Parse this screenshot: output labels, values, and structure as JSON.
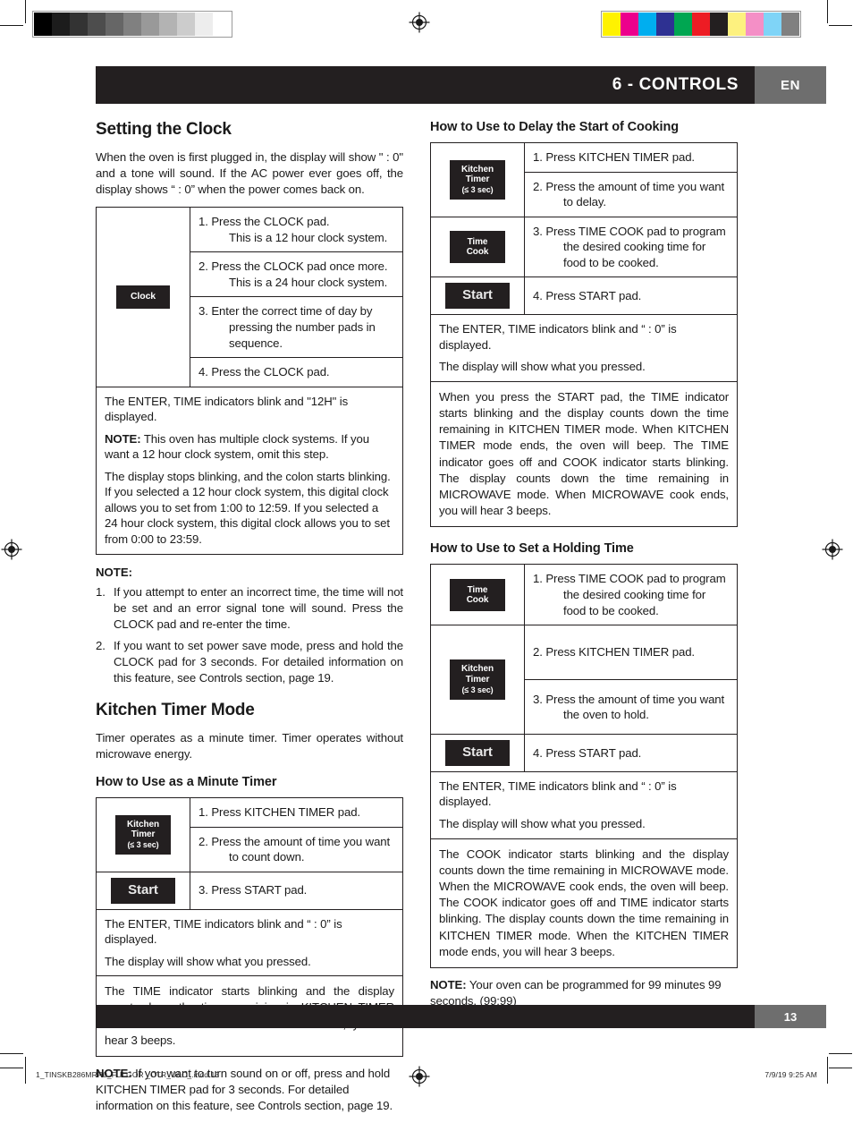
{
  "header": {
    "title": "6 - CONTROLS",
    "language": "EN"
  },
  "footer": {
    "page_number": "13"
  },
  "print_slug": {
    "filename": "1_TINSKB286MRR0_FULGOR _OTR_U&C_.indd   13",
    "timestamp": "7/9/19   9:25 AM"
  },
  "calibration": {
    "gray_wedge": [
      "#000000",
      "#1c1c1c",
      "#333333",
      "#4d4d4d",
      "#666666",
      "#808080",
      "#999999",
      "#b3b3b3",
      "#cccccc",
      "#ededed",
      "#ffffff"
    ],
    "color_bars": [
      "#fff200",
      "#ec008c",
      "#00aeef",
      "#2e3192",
      "#00a651",
      "#ed1c24",
      "#231f20",
      "#fdf17f",
      "#f48fc6",
      "#7fd4f7",
      "#808080"
    ],
    "registration_mark": "registration-target"
  },
  "pads": {
    "clock": {
      "line1": "Clock"
    },
    "kitchen_timer": {
      "line1": "Kitchen",
      "line2": "Timer",
      "line3": "(≤ 3 sec)"
    },
    "time_cook": {
      "line1": "Time",
      "line2": "Cook"
    },
    "start": {
      "line1": "Start"
    }
  },
  "left_column": {
    "setting_clock": {
      "heading": "Setting the Clock",
      "intro": "When the oven is first plugged in, the display will show \" : 0\" and a tone will sound. If the AC power ever goes off, the display shows “ : 0” when the power comes back on.",
      "table": {
        "pad": "clock",
        "steps": [
          {
            "main": "1. Press the CLOCK pad.",
            "cont": "This is a 12 hour clock system."
          },
          {
            "main": "2. Press the CLOCK pad once more.",
            "cont": "This is a 24 hour clock system."
          },
          {
            "main": "3. Enter the correct time of day by",
            "cont": "pressing the number pads in sequence."
          },
          {
            "main": "4. Press the CLOCK pad.",
            "cont": ""
          }
        ],
        "result_rows": [
          {
            "lines": [
              "The ENTER, TIME indicators blink and \"12H\" is displayed.",
              "NOTE: This oven has multiple clock systems. If you want a 12 hour clock system, omit this step.",
              "The display stops blinking, and the colon starts blinking. If you selected a 12 hour clock system, this digital clock allows you to set from 1:00 to 12:59. If you selected a 24 hour clock system, this digital clock allows you to set from 0:00 to 23:59."
            ]
          }
        ]
      },
      "note_heading": "NOTE:",
      "notes": [
        {
          "num": "1.",
          "text": "If you attempt to enter an incorrect time, the time will not be set and an error signal tone will sound. Press the CLOCK pad and re-enter the time."
        },
        {
          "num": "2.",
          "text": "If you want to set power save mode, press and hold the CLOCK pad for 3 seconds. For detailed information on this feature, see Controls section, page 19."
        }
      ]
    },
    "kitchen_timer_mode": {
      "heading": "Kitchen Timer Mode",
      "intro": "Timer operates as a minute timer. Timer operates without microwave energy.",
      "subheading": "How to Use as a Minute Timer",
      "table": {
        "rows": [
          {
            "pad": "kitchen_timer",
            "pad_rowspan": 2,
            "main": "1. Press KITCHEN TIMER pad.",
            "cont": ""
          },
          {
            "pad": null,
            "main": "2. Press the amount of time you want",
            "cont": "to count down."
          },
          {
            "pad": "start",
            "pad_rowspan": 1,
            "main": "3. Press START pad.",
            "cont": ""
          }
        ],
        "result_row_1": [
          "The ENTER, TIME indicators blink and “ : 0” is displayed.",
          "The display will show what you pressed."
        ],
        "result_row_2": "The TIME indicator starts blinking and the display counts down the time remaining in KITCHEN TIMER mode. When KITCHEN TIMER mode ends, you will hear 3 beeps."
      },
      "note": "NOTE: If you want to turn sound on or off, press and hold KITCHEN TIMER pad for 3 seconds. For detailed information on this feature, see Controls section, page 19.",
      "note_label": "NOTE:"
    }
  },
  "right_column": {
    "delay_start": {
      "heading": "How to Use to Delay the Start of Cooking",
      "table": {
        "rows": [
          {
            "pad": "kitchen_timer",
            "main": "1. Press KITCHEN TIMER pad.",
            "cont": ""
          },
          {
            "pad": null,
            "main": "2. Press the amount of time you want",
            "cont": "to delay."
          },
          {
            "pad": "time_cook",
            "main": "3. Press TIME COOK pad to program",
            "cont": "the desired cooking time for food to be cooked."
          },
          {
            "pad": "start",
            "main": "4. Press START pad.",
            "cont": ""
          }
        ],
        "result_row_1": [
          "The ENTER, TIME indicators blink and “ : 0” is displayed.",
          "The display will show what you pressed."
        ],
        "result_row_2": "When you press the START pad, the TIME indicator starts blinking and the display counts down the time remaining in KITCHEN TIMER mode. When KITCHEN TIMER mode ends, the oven will beep. The TIME indicator goes off and COOK indicator starts blinking. The display counts down the time remaining in MICROWAVE mode. When MICROWAVE cook ends, you will hear 3 beeps."
      }
    },
    "holding_time": {
      "heading": "How to Use to Set a Holding Time",
      "table": {
        "rows": [
          {
            "pad": "time_cook",
            "main": "1. Press TIME COOK pad to program",
            "cont": "the desired cooking time for food to be cooked."
          },
          {
            "pad": "kitchen_timer",
            "main": "2. Press KITCHEN TIMER pad.",
            "cont": ""
          },
          {
            "pad": null,
            "main": "3. Press the amount of time you want",
            "cont": "the oven to hold."
          },
          {
            "pad": "start",
            "main": "4. Press START pad.",
            "cont": ""
          }
        ],
        "result_row_1": [
          "The ENTER, TIME indicators blink and “ : 0” is displayed.",
          "The display will show what you pressed."
        ],
        "result_row_2": "The COOK indicator starts blinking and the display counts down the time remaining in MICROWAVE mode. When the MICROWAVE cook ends, the oven will beep. The COOK indicator goes off and TIME indicator starts blinking. The display counts down the time remaining in KITCHEN TIMER mode. When the KITCHEN TIMER mode ends, you will hear 3 beeps."
      },
      "note_label": "NOTE:",
      "note": "NOTE: Your oven can be programmed for 99 minutes 99 seconds. (99:99)"
    }
  }
}
